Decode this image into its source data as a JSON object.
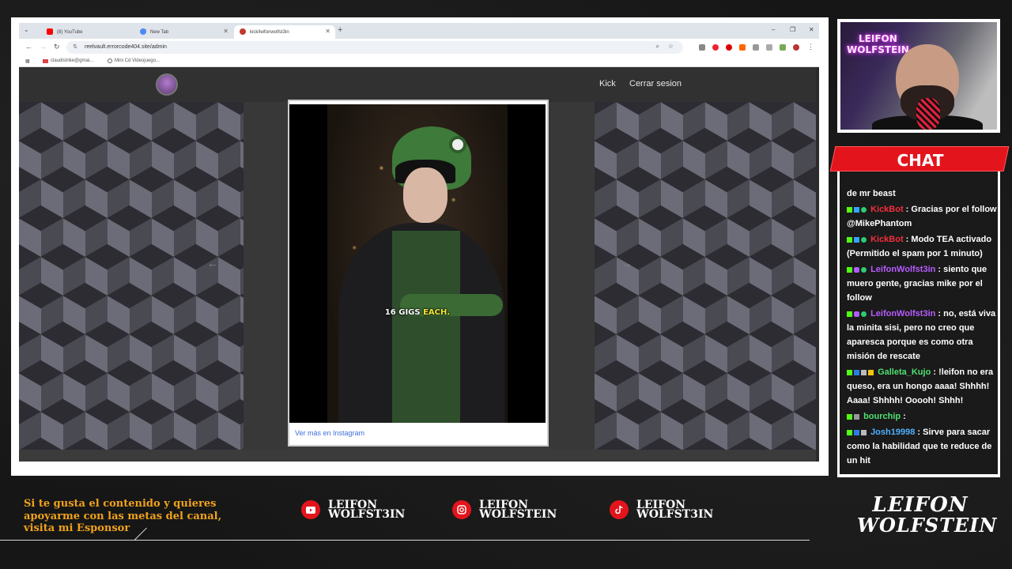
{
  "browser": {
    "tabs": [
      {
        "label": "(8) YouTube",
        "active": false
      },
      {
        "label": "New Tab",
        "active": false
      },
      {
        "label": "kick/leifonwolfst3in",
        "active": true
      }
    ],
    "url": "reelvault.errorcode404.site/admin",
    "bookmarks": [
      "claudistrike@gmai...",
      "Mini Cd Videojuego..."
    ]
  },
  "site": {
    "nav": [
      "Kick",
      "Cerrar sesion"
    ],
    "video_caption_prefix": "16 GIGS ",
    "video_caption_highlight": "EACH.",
    "instagram_link": "Ver más en Instagram"
  },
  "webcam": {
    "neon_line1": "LEIFON",
    "neon_line2": "WOLFSTEIN"
  },
  "chat": {
    "title": "CHAT",
    "messages": [
      {
        "user": "",
        "user_class": "",
        "badges": [],
        "text": "de mr beast"
      },
      {
        "user": "KickBot",
        "user_class": "u-red",
        "badges": [
          "b-k",
          "b-bot",
          "b-check"
        ],
        "text": "Gracias por el follow @MikePhantom"
      },
      {
        "user": "KickBot",
        "user_class": "u-red",
        "badges": [
          "b-k",
          "b-bot",
          "b-check"
        ],
        "text": "Modo TEA activado (Permitido el spam por 1 minuto)"
      },
      {
        "user": "LeifonWolfst3in",
        "user_class": "u-purple",
        "badges": [
          "b-k",
          "b-mic",
          "b-check"
        ],
        "text": "siento que muero gente, gracias mike por el follow"
      },
      {
        "user": "LeifonWolfst3in",
        "user_class": "u-purple",
        "badges": [
          "b-k",
          "b-mic",
          "b-check"
        ],
        "text": "no, está viva la minita sisi, pero no creo que aparesca porque es como otra misión de rescate"
      },
      {
        "user": "Galleta_Kujo",
        "user_class": "u-green",
        "badges": [
          "b-k",
          "b-cube",
          "b-sword",
          "b-gold"
        ],
        "text": "!leifon no era queso, era un hongo aaaa! Shhhh! Aaaa! Shhhh! Ooooh! Shhh!"
      },
      {
        "user": "bourchip",
        "user_class": "u-green",
        "badges": [
          "b-k",
          "b-gray"
        ],
        "text": ""
      },
      {
        "user": "Josh19998",
        "user_class": "u-blue",
        "badges": [
          "b-k",
          "b-cube",
          "b-sword"
        ],
        "text": "Sirve para sacar como la habilidad que te reduce de un hit"
      }
    ]
  },
  "banner": {
    "sponsor_text": "Si te gusta el contenido y quieres apoyarme con las metas del canal, visita mi Esponsor",
    "socials": [
      {
        "icon": "youtube-icon",
        "line1": "LEIFON",
        "line2": "WOLFST3IN"
      },
      {
        "icon": "instagram-icon",
        "line1": "LEIFON",
        "line2": "WOLFSTEIN"
      },
      {
        "icon": "tiktok-icon",
        "line1": "LEIFON",
        "line2": "WOLFST3IN"
      }
    ],
    "brand_line1": "LEIFON",
    "brand_line2": "WOLFSTEIN"
  },
  "colors": {
    "accent_red": "#e3141c",
    "sponsor_orange": "#f0a21c",
    "link_blue": "#3b6fd6"
  }
}
